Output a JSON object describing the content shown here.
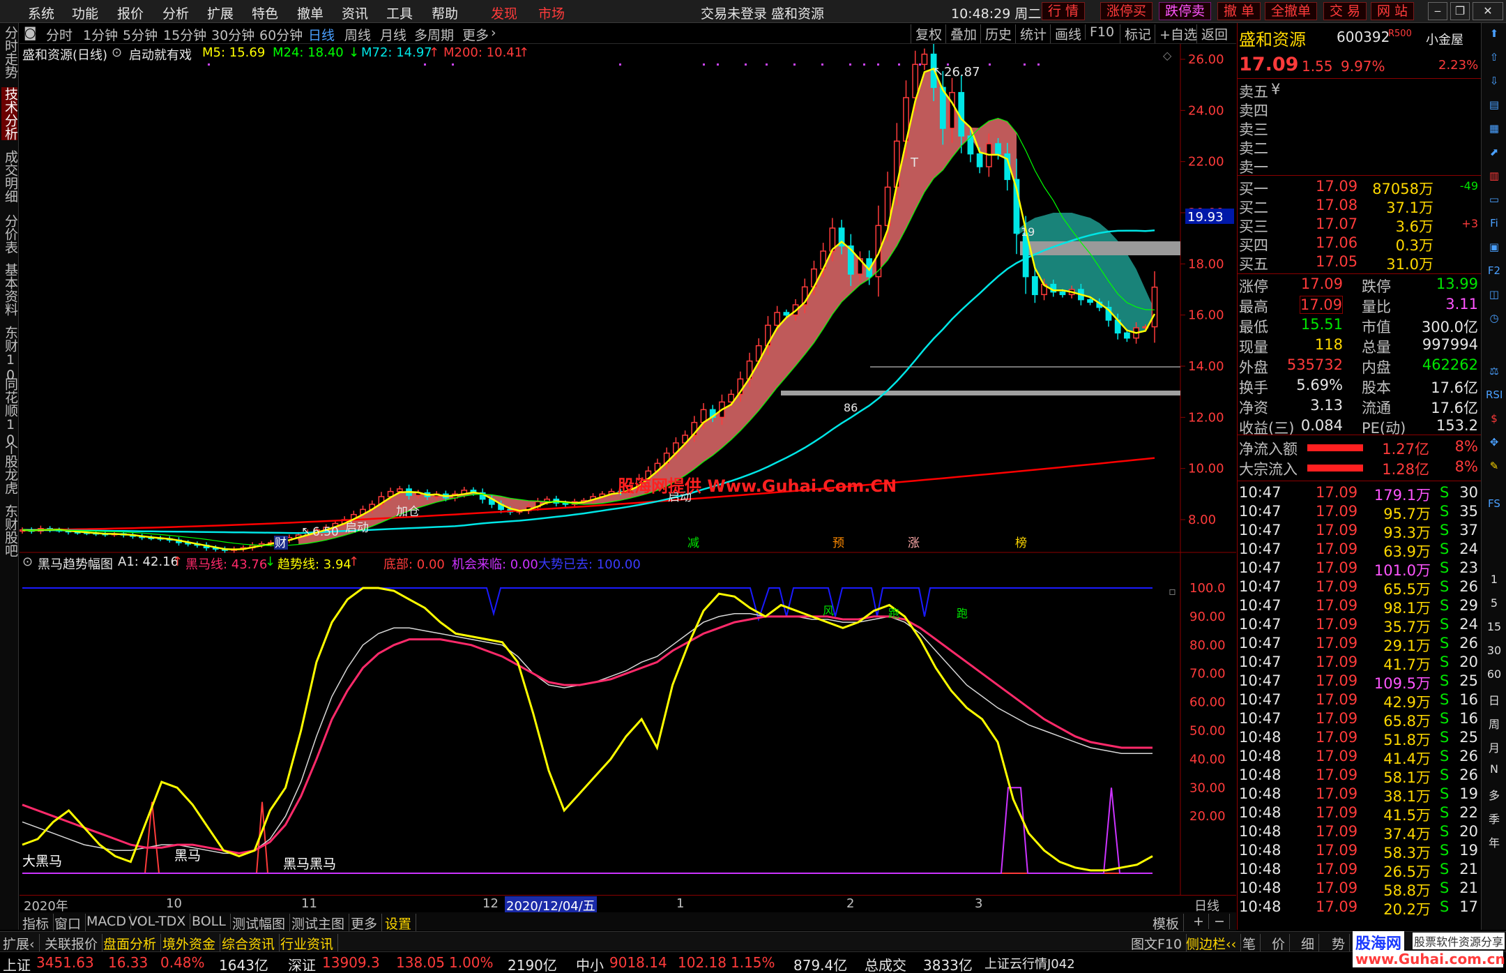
{
  "menu": {
    "items": [
      "系统",
      "功能",
      "报价",
      "分析",
      "扩展",
      "特色",
      "撤单",
      "资讯",
      "工具",
      "帮助"
    ],
    "discover": "发现",
    "market": "市场",
    "center_title": "交易未登录  盛和资源",
    "clock": "10:48:29 周二",
    "quick": [
      "行 情",
      "涨停买",
      "跌停卖",
      "撤 单",
      "全撤单",
      "交 易",
      "网 站"
    ]
  },
  "left_tabs": [
    "分时走势",
    "技术分析",
    "成交明细",
    "分价表",
    "基本资料",
    "东财10",
    "同花顺10",
    "个股龙虎",
    "东财股吧"
  ],
  "period_tabs": [
    "分时",
    "1分钟",
    "5分钟",
    "15分钟",
    "30分钟",
    "60分钟",
    "日线",
    "周线",
    "月线",
    "多周期",
    "更多"
  ],
  "toolbar_right": [
    "复权",
    "叠加",
    "历史",
    "统计",
    "画线",
    "F10",
    "标记",
    "+自选",
    "返回"
  ],
  "overlay": {
    "name": "盛和资源(日线)",
    "strategy": "启动就有戏",
    "ma5": "M5: 15.69",
    "ma24": "M24: 18.40",
    "ma72": "M72: 14.97",
    "ma200": "M200: 10.41"
  },
  "price_axis": [
    "26.00",
    "24.00",
    "22.00",
    "20.00",
    "18.00",
    "16.00",
    "14.00",
    "12.00",
    "10.00",
    "8.00"
  ],
  "price_tag": "19.93",
  "annotations": {
    "high": "26.87",
    "low": "6.50",
    "t": "T",
    "n19": "19",
    "n86": "86",
    "qidong": "启动",
    "jiagong": "加仓",
    "qidong2": "启动",
    "cai": "财",
    "jian": "减",
    "yu": "预",
    "zhang": "涨",
    "bang": "榜"
  },
  "watermark": "股海网提供 Www.Guhai.Com.CN",
  "indicator": {
    "name": "黑马趋势幅图",
    "a1": "A1: 42.16",
    "heima": "黑马线: 43.76",
    "trend": "趋势线: 3.94",
    "dibu": "底部: 0.00",
    "jihui": "机会来临: 0.00",
    "dashi": "大势已去: 100.00",
    "labels": [
      "大黑马",
      "黑马",
      "黑马黑马",
      "风",
      "跑",
      "跑"
    ]
  },
  "ind_axis": [
    "100.0",
    "90.00",
    "80.00",
    "70.00",
    "60.00",
    "50.00",
    "40.00",
    "30.00",
    "20.00"
  ],
  "x_axis": [
    "2020年",
    "10",
    "11",
    "12",
    "2020/12/04/五",
    "1",
    "2",
    "3"
  ],
  "x_axis_right": "日线",
  "bottom_tabs": [
    "指标",
    "窗口",
    "MACD",
    "VOL-TDX",
    "BOLL",
    "测试幅图",
    "测试主图",
    "更多",
    "设置"
  ],
  "bottom_right": [
    "模板",
    "+",
    "−"
  ],
  "ribbon": [
    "扩展‹",
    "关联报价",
    "盘面分析",
    "境外资金",
    "综合资讯",
    "行业资讯"
  ],
  "ribbon_right": [
    "图文F10",
    "侧边栏‹‹",
    "笔",
    "价",
    "细",
    "势"
  ],
  "status": {
    "sh": "上证",
    "sh_v": "3451.63",
    "sh_c": "16.33",
    "sh_p": "0.48%",
    "sh_a": "1643亿",
    "sz": "深证",
    "sz_v": "13909.3",
    "sz_c": "138.05",
    "sz_p": "1.00%",
    "sz_a": "2190亿",
    "zx": "中小",
    "zx_v": "9018.14",
    "zx_c": "102.18",
    "zx_p": "1.15%",
    "zx_a": "879.4亿",
    "total": "总成交",
    "total_v": "3833亿",
    "news": "上证云行情J042",
    "logo": "股海网",
    "logo_sub": "股票软件资源分享",
    "logo_url": "www.Guhai.com.cn"
  },
  "quote": {
    "name": "盛和资源",
    "code": "600392",
    "tag": "R500",
    "btn": "小金屋",
    "price": "17.09",
    "change": "1.55",
    "pct": "9.97%",
    "amp": "2.23%",
    "sells": [
      "卖五",
      "卖四",
      "卖三",
      "卖二",
      "卖一"
    ],
    "sell_extra": "¥",
    "buys": [
      {
        "l": "买一",
        "p": "17.09",
        "v": "87058万",
        "d": "-49"
      },
      {
        "l": "买二",
        "p": "17.08",
        "v": "37.1万",
        "d": ""
      },
      {
        "l": "买三",
        "p": "17.07",
        "v": "3.6万",
        "d": "+3"
      },
      {
        "l": "买四",
        "p": "17.06",
        "v": "0.3万",
        "d": ""
      },
      {
        "l": "买五",
        "p": "17.05",
        "v": "31.0万",
        "d": ""
      }
    ],
    "stats": [
      {
        "a": "涨停",
        "av": "17.09",
        "b": "跌停",
        "bv": "13.99"
      },
      {
        "a": "最高",
        "av": "17.09",
        "b": "量比",
        "bv": "3.11"
      },
      {
        "a": "最低",
        "av": "15.51",
        "b": "市值",
        "bv": "300.0亿"
      },
      {
        "a": "现量",
        "av": "118",
        "b": "总量",
        "bv": "997994"
      },
      {
        "a": "外盘",
        "av": "535732",
        "b": "内盘",
        "bv": "462262"
      },
      {
        "a": "换手",
        "av": "5.69%",
        "b": "股本",
        "bv": "17.6亿"
      },
      {
        "a": "净资",
        "av": "3.13",
        "b": "流通",
        "bv": "17.6亿"
      },
      {
        "a": "收益(三)",
        "av": "0.084",
        "b": "PE(动)",
        "bv": "153.2"
      }
    ],
    "flows": [
      {
        "l": "净流入额",
        "v": "1.27亿",
        "p": "8%"
      },
      {
        "l": "大宗流入",
        "v": "1.28亿",
        "p": "8%"
      }
    ],
    "ticks": [
      [
        "10:47",
        "17.09",
        "179.1万",
        "S",
        "30"
      ],
      [
        "10:47",
        "17.09",
        "95.7万",
        "S",
        "35"
      ],
      [
        "10:47",
        "17.09",
        "93.3万",
        "S",
        "37"
      ],
      [
        "10:47",
        "17.09",
        "63.9万",
        "S",
        "24"
      ],
      [
        "10:47",
        "17.09",
        "101.0万",
        "S",
        "23"
      ],
      [
        "10:47",
        "17.09",
        "65.5万",
        "S",
        "26"
      ],
      [
        "10:47",
        "17.09",
        "98.1万",
        "S",
        "29"
      ],
      [
        "10:47",
        "17.09",
        "35.7万",
        "S",
        "24"
      ],
      [
        "10:47",
        "17.09",
        "29.1万",
        "S",
        "26"
      ],
      [
        "10:47",
        "17.09",
        "41.7万",
        "S",
        "20"
      ],
      [
        "10:47",
        "17.09",
        "109.5万",
        "S",
        "25"
      ],
      [
        "10:47",
        "17.09",
        "42.9万",
        "S",
        "16"
      ],
      [
        "10:47",
        "17.09",
        "65.8万",
        "S",
        "16"
      ],
      [
        "10:48",
        "17.09",
        "51.8万",
        "S",
        "25"
      ],
      [
        "10:48",
        "17.09",
        "41.4万",
        "S",
        "26"
      ],
      [
        "10:48",
        "17.09",
        "58.1万",
        "S",
        "26"
      ],
      [
        "10:48",
        "17.09",
        "38.1万",
        "S",
        "19"
      ],
      [
        "10:48",
        "17.09",
        "41.5万",
        "S",
        "22"
      ],
      [
        "10:48",
        "17.09",
        "37.4万",
        "S",
        "20"
      ],
      [
        "10:48",
        "17.09",
        "58.3万",
        "S",
        "19"
      ],
      [
        "10:48",
        "17.09",
        "26.5万",
        "S",
        "21"
      ],
      [
        "10:48",
        "17.09",
        "58.8万",
        "S",
        "21"
      ],
      [
        "10:48",
        "17.09",
        "20.2万",
        "S",
        "17"
      ]
    ]
  },
  "right_tools": [
    "1",
    "5",
    "15",
    "30",
    "60",
    "日",
    "周",
    "月",
    "N",
    "多",
    "季",
    "年"
  ],
  "colors": {
    "up": "#ff3b3b",
    "down": "#00e6e6",
    "ma5": "#ffff00",
    "ma24": "#00ff00",
    "ma72": "#00e6e6",
    "ma200": "#ff0000",
    "heima": "#ff2a6a",
    "trend": "#ffff00",
    "dashi": "#1a1aff"
  },
  "chart_data": {
    "type": "candlestick",
    "y_range": [
      7.2,
      27.2
    ],
    "closes": [
      7.6,
      7.55,
      7.65,
      7.6,
      7.58,
      7.52,
      7.5,
      7.48,
      7.45,
      7.42,
      7.45,
      7.4,
      7.35,
      7.3,
      7.28,
      7.25,
      7.2,
      7.1,
      7.05,
      7.0,
      6.9,
      6.85,
      6.8,
      6.85,
      6.9,
      7.0,
      7.05,
      7.1,
      7.2,
      7.3,
      7.4,
      7.5,
      7.6,
      7.7,
      7.85,
      8.0,
      8.2,
      8.4,
      8.6,
      8.9,
      9.1,
      9.2,
      8.95,
      9.05,
      8.9,
      9.0,
      8.85,
      9.0,
      9.15,
      9.05,
      8.8,
      8.6,
      8.4,
      8.3,
      8.35,
      8.5,
      8.7,
      8.8,
      8.65,
      8.6,
      8.7,
      8.75,
      8.9,
      9.0,
      9.1,
      9.05,
      9.3,
      9.6,
      9.9,
      10.2,
      10.6,
      11.0,
      11.3,
      11.8,
      12.3,
      12.0,
      12.6,
      12.9,
      13.5,
      14.2,
      14.8,
      15.6,
      16.1,
      16.0,
      16.4,
      17.1,
      17.8,
      18.5,
      19.4,
      18.7,
      17.6,
      18.2,
      17.5,
      19.5,
      21.0,
      22.8,
      24.5,
      25.8,
      26.2,
      24.9,
      23.3,
      24.7,
      23.0,
      22.3,
      21.8,
      22.7,
      22.3,
      21.3,
      19.2,
      17.5,
      16.8,
      17.2,
      16.9,
      16.8,
      17.0,
      16.6,
      16.5,
      16.3,
      15.8,
      15.3,
      15.1,
      15.5,
      15.54,
      17.09
    ],
    "ma200_start": 7.6,
    "ma200_end": 10.41,
    "ind_heima_end": 43.76,
    "ind_a1_end": 42.16,
    "ind_trend_end": 3.94
  }
}
